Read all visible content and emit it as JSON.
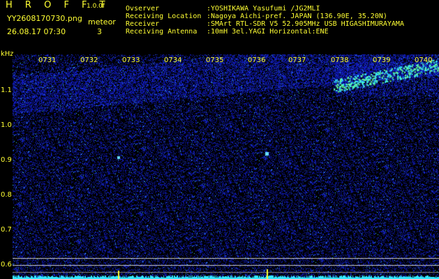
{
  "header": {
    "title": "H R O F F T",
    "version": "1.0.0f",
    "filename": "YY2608170730.png",
    "timestamp": "26.08.17 07:30",
    "meteor_label": "meteor",
    "meteor_count": "3"
  },
  "info": [
    {
      "key": "Ovserver",
      "value": ":YOSHIKAWA Yasufumi /JG2MLI"
    },
    {
      "key": "Receiving Location",
      "value": ":Nagoya Aichi-pref. JAPAN (136.90E, 35.20N)"
    },
    {
      "key": "Receiver",
      "value": ":SMArt RTL-SDR V5 52.905MHz USB HIGASHIMURAYAMA"
    },
    {
      "key": "Receiving Antenna",
      "value": ":10mH 3el.YAGI Horizontal:ENE"
    }
  ],
  "axis": {
    "unit": "kHz",
    "y_labels": [
      "1.1",
      "1.0",
      "0.9",
      "0.8",
      "0.7",
      "0.6"
    ],
    "time_labels": [
      "0731",
      "0732",
      "0733",
      "0734",
      "0735",
      "0736",
      "0737",
      "0738",
      "0739",
      "0740"
    ]
  },
  "colors": {
    "text": "#ffff33",
    "background": "#000000",
    "noise": "#1a2bd6",
    "bright": "#33e8ff",
    "echo": "#66ff99"
  }
}
